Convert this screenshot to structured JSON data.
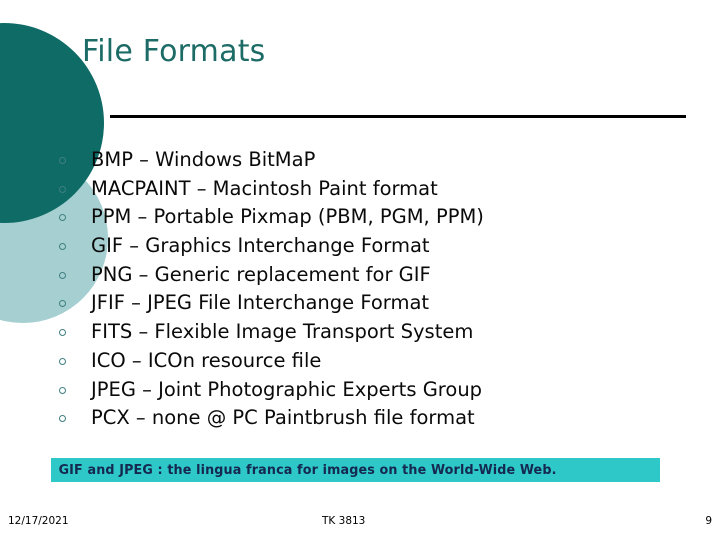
{
  "slide": {
    "title": "File Formats",
    "colors": {
      "title_teal": "#1c6b66",
      "circle_dark": "#0f6b66",
      "circle_light": "#a5cfd0",
      "rule_black": "#000000",
      "highlight_bg": "#2ec8c8",
      "highlight_text": "#15284f",
      "bullet_marker": "#3f7f80",
      "body_text": "#0a0a0a",
      "background": "#ffffff"
    }
  },
  "bullets": [
    {
      "text": "BMP – Windows BitMaP"
    },
    {
      "text": "MACPAINT – Macintosh Paint format"
    },
    {
      "text": "PPM – Portable Pixmap (PBM, PGM, PPM)"
    },
    {
      "text": "GIF – Graphics Interchange Format"
    },
    {
      "text": "PNG – Generic replacement for GIF"
    },
    {
      "text": "JFIF – JPEG File Interchange Format"
    },
    {
      "text": "FITS – Flexible Image Transport System"
    },
    {
      "text": "ICO – ICOn resource file"
    },
    {
      "text": "JPEG – Joint Photographic Experts Group"
    },
    {
      "text": "PCX – none @ PC Paintbrush file format"
    }
  ],
  "highlight": {
    "text": "GIF and JPEG : the lingua franca for images on the World-Wide Web."
  },
  "footer": {
    "date": "12/17/2021",
    "code": "TK 3813",
    "page": "9"
  },
  "icons": {
    "bullet": "hollow-circle-icon"
  }
}
